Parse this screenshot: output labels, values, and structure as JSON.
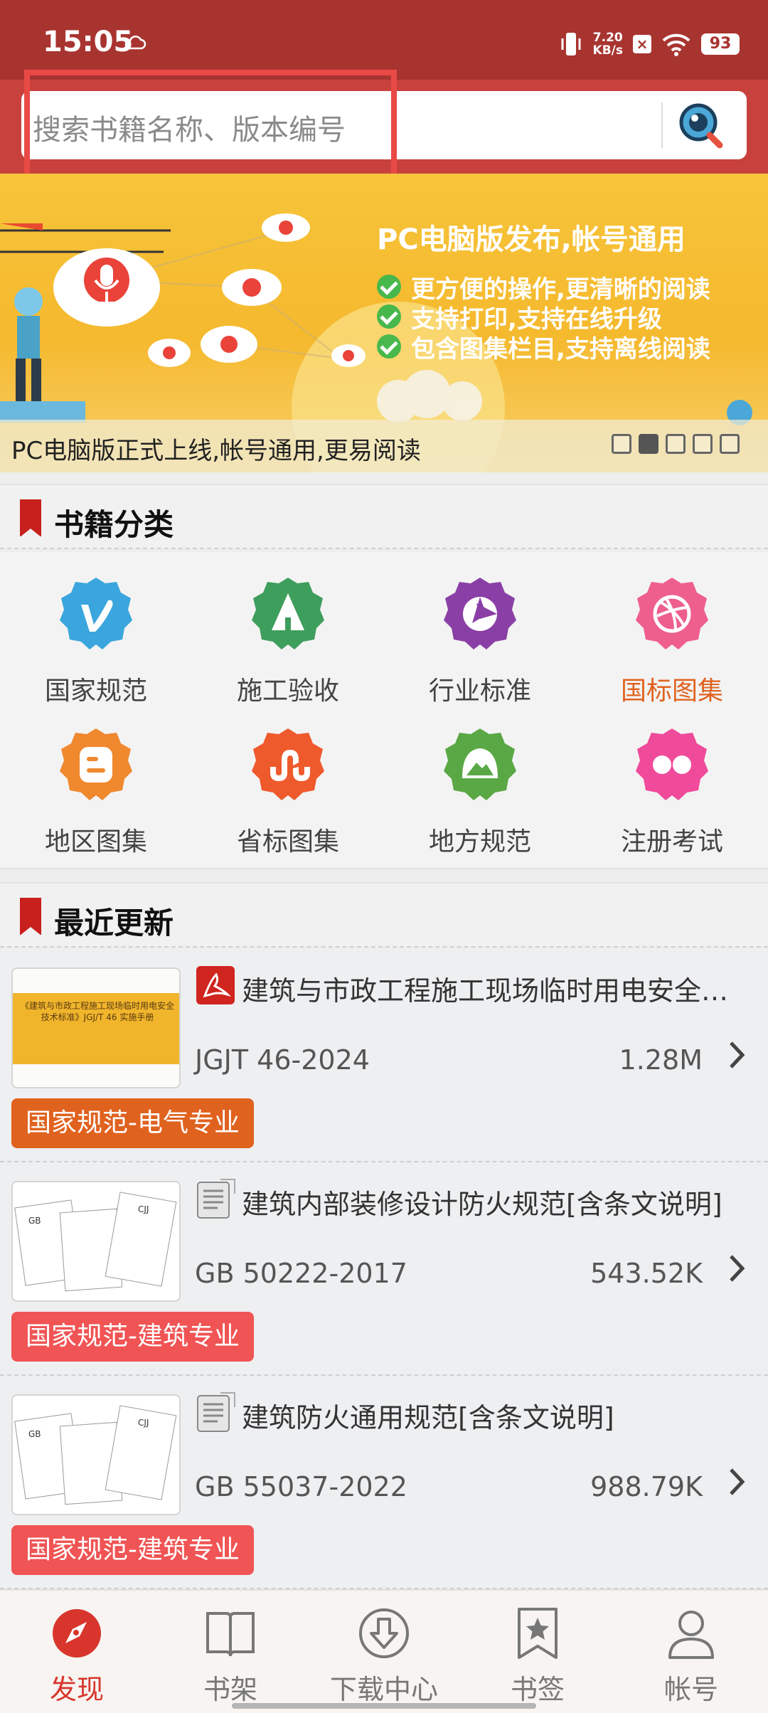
{
  "status_bar": {
    "time": "15:05",
    "net_speed_value": "7.20",
    "net_speed_unit": "KB/s",
    "battery": "93"
  },
  "search": {
    "placeholder": "搜索书籍名称、版本编号"
  },
  "banner": {
    "headline": "PC电脑版发布,帐号通用",
    "features": [
      "更方便的操作,更清晰的阅读",
      "支持打印,支持在线升级",
      "包含图集栏目,支持离线阅读"
    ],
    "caption": "PC电脑版正式上线,帐号通用,更易阅读",
    "slide_count": 5,
    "active_slide": 2
  },
  "categories": {
    "title": "书籍分类",
    "items": [
      {
        "label": "国家规范",
        "icon": "vimeo-badge-icon",
        "color": "#3aa6dd"
      },
      {
        "label": "施工验收",
        "icon": "tree-badge-icon",
        "color": "#3e9e5c"
      },
      {
        "label": "行业标准",
        "icon": "aperture-badge-icon",
        "color": "#8a3fa6"
      },
      {
        "label": "国标图集",
        "icon": "dribbble-badge-icon",
        "color": "#ee5f8d",
        "highlighted": true
      },
      {
        "label": "地区图集",
        "icon": "blogger-badge-icon",
        "color": "#f0882e"
      },
      {
        "label": "省标图集",
        "icon": "stumbleupon-badge-icon",
        "color": "#ef5a2c"
      },
      {
        "label": "地方规范",
        "icon": "mountain-badge-icon",
        "color": "#5aa845"
      },
      {
        "label": "注册考试",
        "icon": "flickr-badge-icon",
        "color": "#f04a9b"
      }
    ]
  },
  "recent": {
    "title": "最近更新",
    "items": [
      {
        "title": "建筑与市政工程施工现场临时用电安全技术标准",
        "code": "JGJT 46-2024",
        "size": "1.28M",
        "file_icon": "pdf-icon",
        "tag": "国家规范-电气专业",
        "tag_color": "#e0621f",
        "thumb_text": "《建筑与市政工程施工现场临时用电安全技术标准》JGJ/T 46 实施手册"
      },
      {
        "title": "建筑内部装修设计防火规范[含条文说明]",
        "code": "GB 50222-2017",
        "size": "543.52K",
        "file_icon": "document-icon",
        "tag": "国家规范-建筑专业",
        "tag_color": "#f05454"
      },
      {
        "title": "建筑防火通用规范[含条文说明]",
        "code": "GB 55037-2022",
        "size": "988.79K",
        "file_icon": "document-icon",
        "tag": "国家规范-建筑专业",
        "tag_color": "#f05454"
      }
    ]
  },
  "bottom_nav": {
    "items": [
      {
        "label": "发现",
        "icon": "compass-icon",
        "active": true
      },
      {
        "label": "书架",
        "icon": "book-icon"
      },
      {
        "label": "下载中心",
        "icon": "download-icon"
      },
      {
        "label": "书签",
        "icon": "bookmark-star-icon"
      },
      {
        "label": "帐号",
        "icon": "user-icon"
      }
    ]
  },
  "colors": {
    "header": "#c8413c",
    "status_bar": "#a83430",
    "accent": "#d8362c",
    "highlight_box": "#e94a46"
  }
}
